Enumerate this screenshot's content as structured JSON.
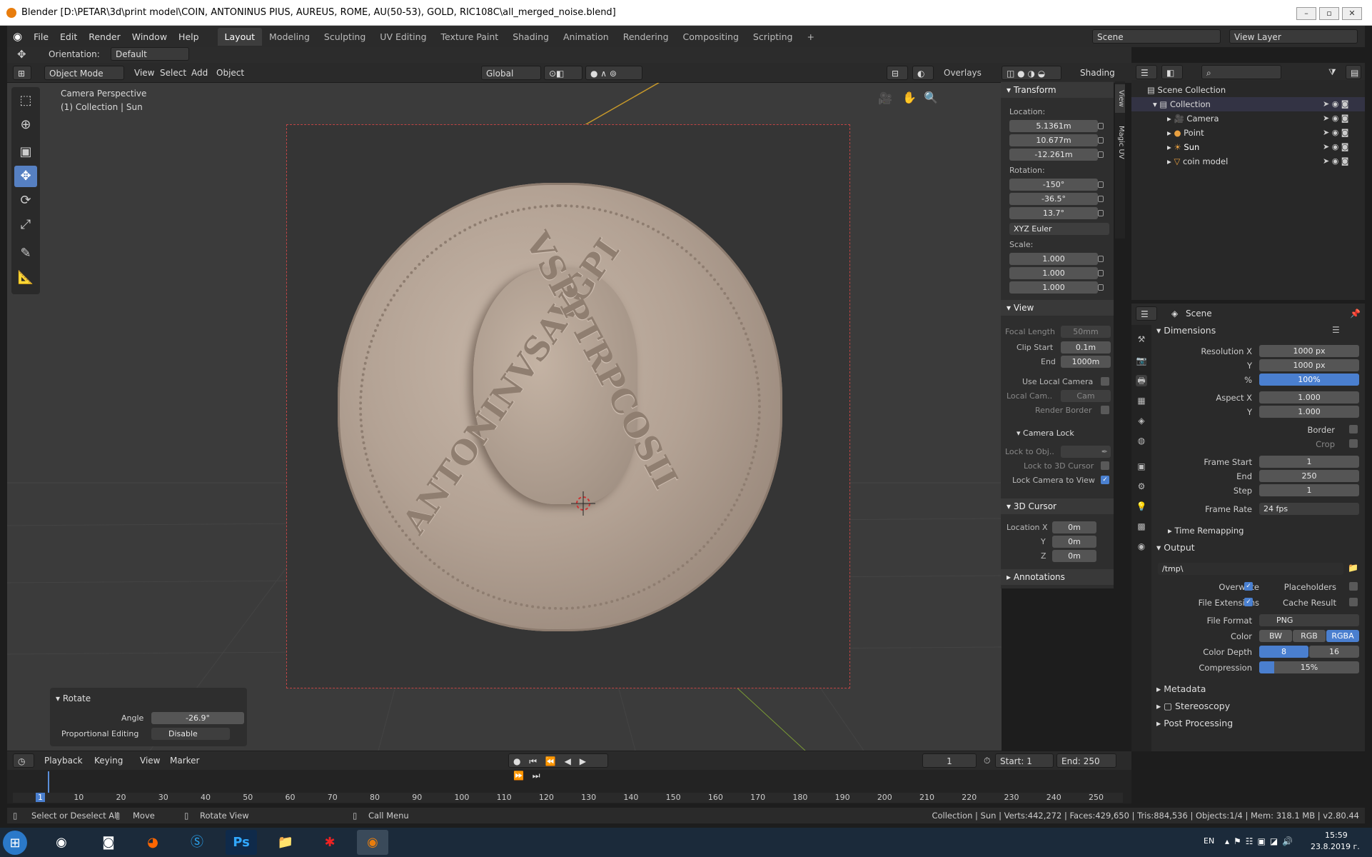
{
  "window": {
    "title": "Blender [D:\\PETAR\\3d\\print model\\COIN, ANTONINUS PIUS, AUREUS, ROME, AU(50-53), GOLD, RIC108C\\all_merged_noise.blend]"
  },
  "menu": [
    "File",
    "Edit",
    "Render",
    "Window",
    "Help"
  ],
  "workspaces": [
    "Layout",
    "Modeling",
    "Sculpting",
    "UV Editing",
    "Texture Paint",
    "Shading",
    "Animation",
    "Rendering",
    "Compositing",
    "Scripting"
  ],
  "scene_field": "Scene",
  "view_layer_field": "View Layer",
  "tool_options": {
    "orientation_label": "Orientation:",
    "orientation_value": "Default"
  },
  "viewport_header": {
    "mode": "Object Mode",
    "menus": [
      "View",
      "Select",
      "Add",
      "Object"
    ],
    "transform": "Global",
    "overlays": "Overlays",
    "shading": "Shading"
  },
  "viewport": {
    "info1": "Camera Perspective",
    "info2": "(1) Collection | Sun"
  },
  "coin": {
    "legend_left": "ANTONINVSAVGPI",
    "legend_right": "VSPPTRPCOSII"
  },
  "npanel": {
    "tabs": [
      "View",
      "Magic UV"
    ],
    "transform_header": "Transform",
    "location_label": "Location:",
    "location": [
      {
        "axis": "X:",
        "value": "5.1361m"
      },
      {
        "axis": "Y:",
        "value": "10.677m"
      },
      {
        "axis": "Z:",
        "value": "-12.261m"
      }
    ],
    "rotation_label": "Rotation:",
    "rotation": [
      {
        "axis": "X:",
        "value": "-150°"
      },
      {
        "axis": "Y:",
        "value": "-36.5°"
      },
      {
        "axis": "Z:",
        "value": "13.7°"
      }
    ],
    "rotation_mode": "XYZ Euler",
    "scale_label": "Scale:",
    "scale": [
      {
        "axis": "X:",
        "value": "1.000"
      },
      {
        "axis": "Y:",
        "value": "1.000"
      },
      {
        "axis": "Z:",
        "value": "1.000"
      }
    ],
    "view_header": "View",
    "focal_label": "Focal Length",
    "focal_value": "50mm",
    "clip_start_label": "Clip Start",
    "clip_start": "0.1m",
    "clip_end_label": "End",
    "clip_end": "1000m",
    "use_local_camera": "Use Local Camera",
    "local_cam_label": "Local Cam..",
    "local_cam_value": "Cam",
    "render_border": "Render Border",
    "camera_lock_header": "Camera Lock",
    "lock_to_obj": "Lock to Obj..",
    "lock_to_cursor": "Lock to 3D Cursor",
    "lock_camera_to_view": "Lock Camera to View",
    "cursor_header": "3D Cursor",
    "cursor_loc_label": "Location X",
    "cursor": [
      {
        "axis": "Location X",
        "value": "0m"
      },
      {
        "axis": "Y",
        "value": "0m"
      },
      {
        "axis": "Z",
        "value": "0m"
      }
    ],
    "annotations_header": "Annotations"
  },
  "outliner": {
    "scene_collection": "Scene Collection",
    "collection": "Collection",
    "items": [
      "Camera",
      "Point",
      "Sun",
      "coin model"
    ]
  },
  "properties": {
    "context": "Scene",
    "dimensions": "Dimensions",
    "res_x_label": "Resolution X",
    "res_x": "1000 px",
    "res_y_label": "Y",
    "res_y": "1000 px",
    "pct_label": "%",
    "pct": "100%",
    "aspect_x_label": "Aspect X",
    "aspect_x": "1.000",
    "aspect_y_label": "Y",
    "aspect_y": "1.000",
    "border": "Border",
    "crop": "Crop",
    "frame_start_label": "Frame Start",
    "frame_start": "1",
    "frame_end_label": "End",
    "frame_end": "250",
    "frame_step_label": "Step",
    "frame_step": "1",
    "frame_rate_label": "Frame Rate",
    "frame_rate": "24 fps",
    "time_remapping": "Time Remapping",
    "output": "Output",
    "path": "/tmp\\",
    "overwrite": "Overwrite",
    "placeholders": "Placeholders",
    "file_ext": "File Extensions",
    "cache_result": "Cache Result",
    "file_format_label": "File Format",
    "file_format": "PNG",
    "color_label": "Color",
    "color_opts": [
      "BW",
      "RGB",
      "RGBA"
    ],
    "color_depth_label": "Color Depth",
    "depth_opts": [
      "8",
      "16"
    ],
    "compression_label": "Compression",
    "compression": "15%",
    "metadata": "Metadata",
    "stereoscopy": "Stereoscopy",
    "post_processing": "Post Processing"
  },
  "last_op": {
    "title": "Rotate",
    "angle_label": "Angle",
    "angle": "-26.9°",
    "prop_label": "Proportional Editing",
    "prop_value": "Disable"
  },
  "timeline": {
    "menus": [
      "Playback",
      "Keying",
      "View",
      "Marker"
    ],
    "current": "1",
    "start_label": "Start:",
    "start": "1",
    "end_label": "End:",
    "end": "250",
    "ticks": [
      "1",
      "10",
      "20",
      "30",
      "40",
      "50",
      "60",
      "70",
      "80",
      "90",
      "100",
      "110",
      "120",
      "130",
      "140",
      "150",
      "160",
      "170",
      "180",
      "190",
      "200",
      "210",
      "220",
      "230",
      "240",
      "250"
    ]
  },
  "status": {
    "select": "Select or Deselect All",
    "move": "Move",
    "rotate": "Rotate View",
    "menu": "Call Menu",
    "stats": "Collection | Sun | Verts:442,272 | Faces:429,650 | Tris:884,536 | Objects:1/4 | Mem: 318.1 MB | v2.80.44"
  },
  "taskbar": {
    "lang": "EN",
    "time": "15:59",
    "date": "23.8.2019 г."
  }
}
